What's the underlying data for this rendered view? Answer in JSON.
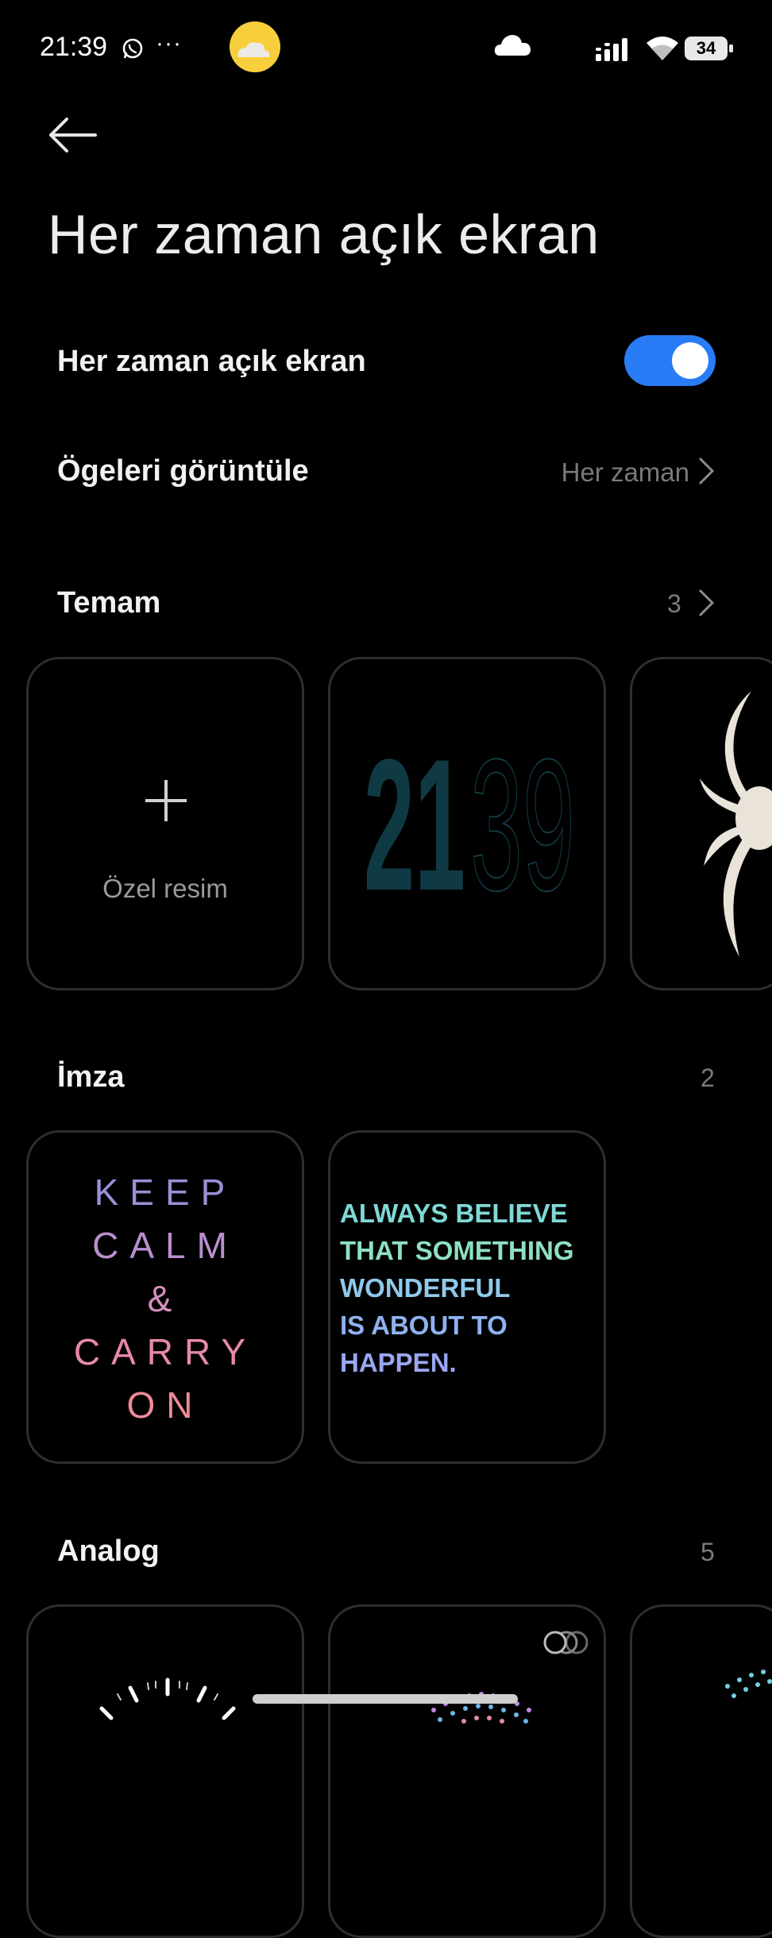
{
  "status_bar": {
    "time": "21:39",
    "more": "···",
    "battery": "34"
  },
  "page": {
    "title": "Her zaman açık ekran"
  },
  "settings": {
    "aod_label": "Her zaman açık ekran",
    "aod_enabled": true,
    "display_items_label": "Ögeleri görüntüle",
    "display_items_value": "Her zaman"
  },
  "sections": {
    "temam": {
      "title": "Temam",
      "count": "3",
      "custom_label": "Özel resim",
      "digits_bold": "21",
      "digits_outline": "39"
    },
    "imza": {
      "title": "İmza",
      "count": "2",
      "keep_calm": [
        "KEEP",
        "CALM",
        "&",
        "CARRY",
        "ON"
      ],
      "always": [
        "ALWAYS BELIEVE",
        "THAT SOMETHING",
        "WONDERFUL",
        "IS ABOUT TO",
        "HAPPEN."
      ]
    },
    "analog": {
      "title": "Analog",
      "count": "5"
    }
  },
  "colors": {
    "accent": "#2a7bf6",
    "toggle_knob": "#ffffff",
    "card_border": "#2e2e2e"
  },
  "icons": [
    "whatsapp-icon",
    "weather-icon",
    "cloud-icon",
    "signal-icon",
    "wifi-icon",
    "battery-icon",
    "back-arrow-icon",
    "chevron-right-icon",
    "plus-icon",
    "overlap-circles-icon"
  ]
}
